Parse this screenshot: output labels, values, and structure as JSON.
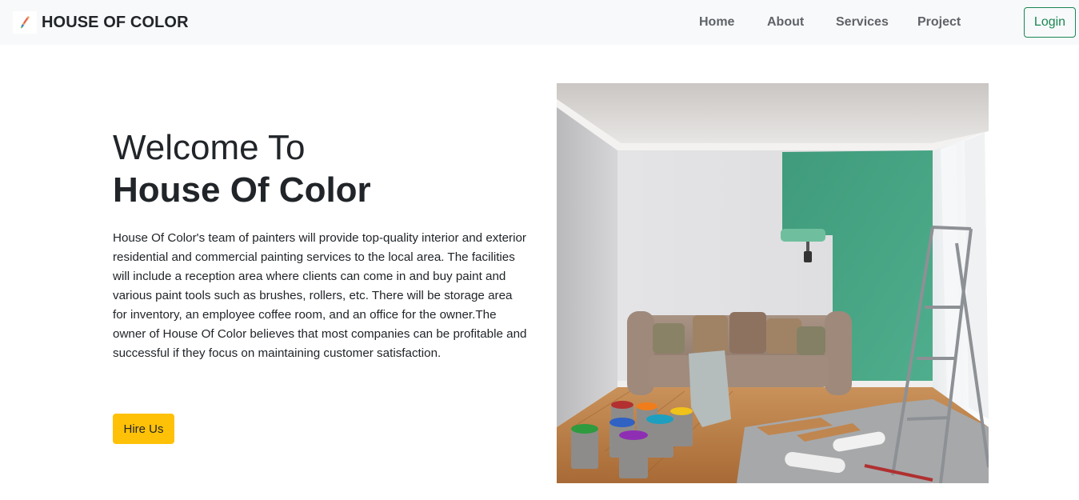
{
  "navbar": {
    "brand": {
      "text": "HOUSE OF COLOR",
      "icon": "paint-brush-logo-icon"
    },
    "links": [
      {
        "label": "Home"
      },
      {
        "label": "About"
      },
      {
        "label": "Services"
      },
      {
        "label": "Project"
      }
    ],
    "login_label": "Login"
  },
  "hero": {
    "title_line1": "Welcome To",
    "title_line2": "House Of Color",
    "paragraph": "House Of Color's team of painters will provide top-quality interior and exterior residential and commercial painting services to the local area. The facilities will include a reception area where clients can come in and buy paint and various paint tools such as brushes, rollers, etc. There will be storage area for inventory, an employee coffee room, and an office for the owner.The owner of House Of Color believes that most companies can be profitable and successful if they focus on maintaining customer satisfaction.",
    "cta_label": "Hire Us",
    "image": {
      "icon": "room-painting-illustration",
      "accent_color": "#46a383"
    }
  },
  "colors": {
    "navbar_bg": "#f8f9fa",
    "login_outline": "#198754",
    "cta_bg": "#ffc107",
    "text": "#212529"
  }
}
